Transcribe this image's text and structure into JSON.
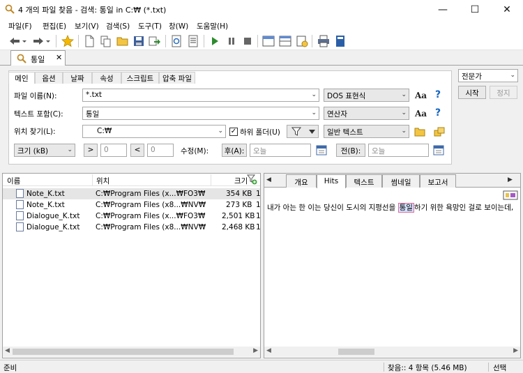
{
  "window": {
    "title": "4 개의 파일 찾음 - 검색: 통일 in C:₩ (*.txt)",
    "minimize": "—",
    "maximize": "☐",
    "close": "✕"
  },
  "menu": [
    "파일(F)",
    "편집(E)",
    "보기(V)",
    "검색(S)",
    "도구(T)",
    "창(W)",
    "도움말(H)"
  ],
  "doc_tab": {
    "label": "통일",
    "close": "✕"
  },
  "panel": {
    "tabs": [
      "메인",
      "옵션",
      "날짜",
      "속성",
      "스크립트",
      "압축 파일"
    ],
    "filename_label": "파일 이름(N):",
    "filename_value": "*.txt",
    "filename_editor": "DOS 표현식",
    "content_label": "텍스트 포함(C):",
    "content_value": "통일",
    "content_mode": "연산자",
    "location_label": "위치 찾기(L):",
    "location_value": "C:₩",
    "subfolders_label": "하위 폴더(U)",
    "subfolders_check": "✓",
    "text_type": "일반 텍스트",
    "size_unit": "크기 (kB)",
    "gt": ">",
    "gt_value": "0",
    "lt": "<",
    "lt_value": "0",
    "modified_label": "수정(M):",
    "after_button": "후(A):",
    "after_value": "오늘",
    "before_button": "전(B):",
    "before_value": "오늘",
    "aa": "Aa",
    "help": "?"
  },
  "side": {
    "mode": "전문가",
    "start": "시작",
    "stop": "정지"
  },
  "results": {
    "columns": [
      "이름",
      "위치",
      "크기"
    ],
    "rows": [
      {
        "name": "Note_K.txt",
        "location": "C:₩Program Files (x...₩FO3₩",
        "size": "354 KB",
        "extra": "1"
      },
      {
        "name": "Note_K.txt",
        "location": "C:₩Program Files (x8...₩NV₩",
        "size": "273 KB",
        "extra": "1"
      },
      {
        "name": "Dialogue_K.txt",
        "location": "C:₩Program Files (x...₩FO3₩",
        "size": "2,501 KB",
        "extra": "1"
      },
      {
        "name": "Dialogue_K.txt",
        "location": "C:₩Program Files (x8...₩NV₩",
        "size": "2,468 KB",
        "extra": "1"
      }
    ]
  },
  "preview": {
    "tabs": [
      "개요",
      "Hits",
      "텍스트",
      "썸네일",
      "보고서"
    ],
    "nav_left": "◀",
    "nav_right": "▶",
    "text_before": "내가 아는 한 이는 당신이 도시의 지평선을 ",
    "text_hit": "통일",
    "text_after": "하기 위한 욕망인 걸로 보이는데,"
  },
  "status": {
    "left": "준비",
    "found": "찾음:: 4 항목 (5.46 MB)",
    "select": "선택"
  }
}
